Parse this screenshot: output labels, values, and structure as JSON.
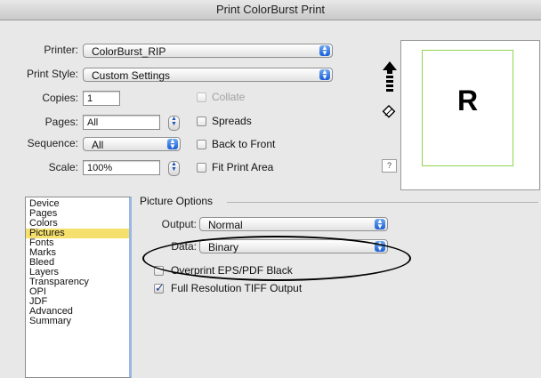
{
  "window": {
    "title": "Print ColorBurst Print"
  },
  "printer": {
    "label": "Printer:",
    "value": "ColorBurst_RIP"
  },
  "print_style": {
    "label": "Print Style:",
    "value": "Custom Settings"
  },
  "copies": {
    "label": "Copies:",
    "value": "1"
  },
  "pages": {
    "label": "Pages:",
    "value": "All"
  },
  "sequence": {
    "label": "Sequence:",
    "value": "All"
  },
  "scale": {
    "label": "Scale:",
    "value": "100%"
  },
  "options": {
    "collate": {
      "label": "Collate",
      "checked": false,
      "enabled": false
    },
    "spreads": {
      "label": "Spreads",
      "checked": false
    },
    "back_to_front": {
      "label": "Back to Front",
      "checked": false
    },
    "fit_print_area": {
      "label": "Fit Print Area",
      "checked": false
    }
  },
  "preview": {
    "page_letter": "R",
    "help": "?",
    "icons": [
      "page-orientation-arrow-icon",
      "paper-feed-icon"
    ]
  },
  "sidebar": {
    "items": [
      "Device",
      "Pages",
      "Colors",
      "Pictures",
      "Fonts",
      "Marks",
      "Bleed",
      "Layers",
      "Transparency",
      "OPI",
      "JDF",
      "Advanced",
      "Summary"
    ],
    "selected": "Pictures"
  },
  "picture_options": {
    "title": "Picture Options",
    "output": {
      "label": "Output:",
      "value": "Normal"
    },
    "data": {
      "label": "Data:",
      "value": "Binary"
    },
    "overprint": {
      "label": "Overprint EPS/PDF Black",
      "checked": false
    },
    "full_res_tiff": {
      "label": "Full Resolution TIFF Output",
      "checked": true
    }
  },
  "colors": {
    "selection_highlight": "#f5e06d",
    "margin_guide": "#8ed44e",
    "accent": "#1a5fd6"
  }
}
